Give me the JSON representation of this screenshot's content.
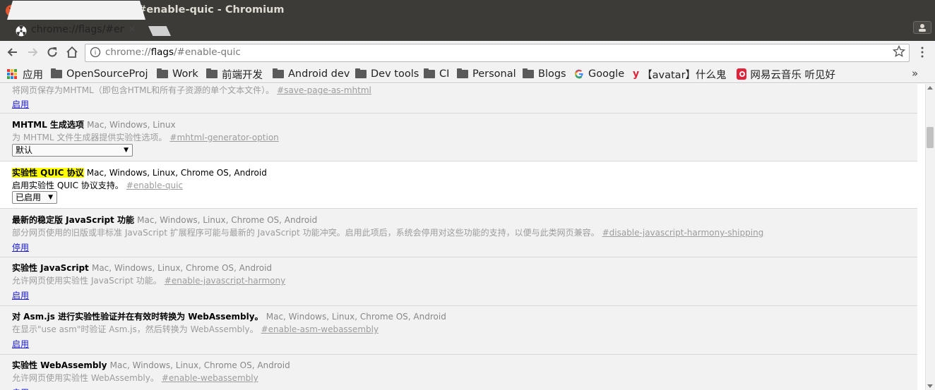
{
  "window": {
    "title": "chrome://flags/#enable-quic - Chromium",
    "close_glyph": "✕",
    "min_glyph": "–",
    "max_glyph": "▢"
  },
  "tab": {
    "title": "chrome://flags/#enable-quic",
    "close_glyph": "✕",
    "icon": "radiation-icon"
  },
  "toolbar": {
    "url_scheme": "chrome://",
    "url_host": "flags",
    "url_rest": "/#enable-quic",
    "info_glyph": "i"
  },
  "bookmarks": {
    "apps_label": "应用",
    "items": [
      "OpenSourceProj",
      "Work",
      "前端开发",
      "Android dev",
      "Dev tools",
      "CI",
      "Personal",
      "Blogs"
    ],
    "google_label": "Google",
    "avatar_label": "【avatar】什么鬼",
    "music_label": "网易云音乐 听见好",
    "more_glyph": "»"
  },
  "flags": [
    {
      "name": "",
      "platforms": "",
      "desc": "将网页保存为MHTML（即包含HTML和所有子资源的单个文本文件）。",
      "hash": "#save-page-as-mhtml",
      "action": "启用"
    },
    {
      "name": "MHTML 生成选项",
      "platforms": "Mac, Windows, Linux",
      "desc": "为 MHTML 文件生成器提供实验性选项。",
      "hash": "#mhtml-generator-option",
      "select": "默认"
    },
    {
      "name_highlight": "实验性 QUIC 协议",
      "platforms": "Mac, Windows, Linux, Chrome OS, Android",
      "desc": "启用实验性 QUIC 协议支持。",
      "hash": "#enable-quic",
      "select": "已启用"
    },
    {
      "name": "最新的稳定版 JavaScript 功能",
      "platforms": "Mac, Windows, Linux, Chrome OS, Android",
      "desc": "部分网页使用的旧版或非标准 JavaScript 扩展程序可能与最新的 JavaScript 功能冲突。启用此项后，系统会停用对这些功能的支持，以便与此类网页兼容。",
      "hash": "#disable-javascript-harmony-shipping",
      "action": "停用"
    },
    {
      "name": "实验性 JavaScript",
      "platforms": "Mac, Windows, Linux, Chrome OS, Android",
      "desc": "允许网页使用实验性 JavaScript 功能。",
      "hash": "#enable-javascript-harmony",
      "action": "启用"
    },
    {
      "name": "对 Asm.js 进行实验性验证并在有效时转换为 WebAssembly。",
      "platforms": "Mac, Windows, Linux, Chrome OS, Android",
      "desc": "在显示\"use asm\"时验证 Asm.js，然后转换为 WebAssembly。",
      "hash": "#enable-asm-webassembly",
      "action": "启用"
    },
    {
      "name": "实验性 WebAssembly",
      "platforms": "Mac, Windows, Linux, Chrome OS, Android",
      "desc": "允许网页使用实验性 WebAssembly。",
      "hash": "#enable-webassembly",
      "action": "启用"
    }
  ],
  "colors": {
    "titlebar": "#3c3b37",
    "highlight": "#ffff00",
    "link": "#1a1acc",
    "close_button": "#e5572f"
  }
}
